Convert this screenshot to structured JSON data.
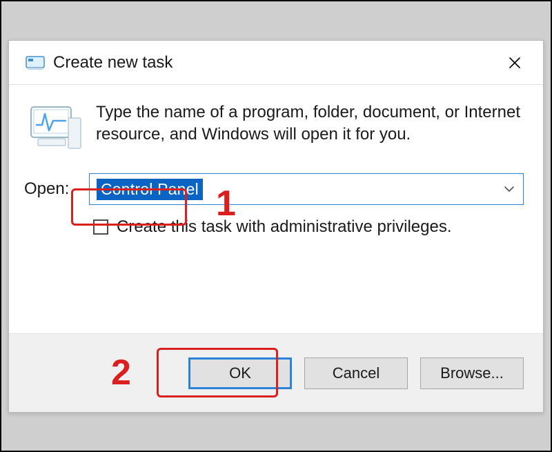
{
  "dialog": {
    "title": "Create new task",
    "prompt": "Type the name of a program, folder, document, or Internet resource, and Windows will open it for you.",
    "open_label": "Open:",
    "open_value": "Control Panel",
    "admin_checkbox_label": "Create this task with administrative privileges.",
    "admin_checked": false,
    "buttons": {
      "ok": "OK",
      "cancel": "Cancel",
      "browse": "Browse..."
    },
    "icons": {
      "app": "run-dialog-icon",
      "machine": "pc-activity-icon",
      "close": "close-icon",
      "dropdown": "chevron-down-icon"
    }
  },
  "annotations": {
    "step1": "1",
    "step2": "2"
  },
  "colors": {
    "annotation_red": "#db1f1f",
    "focus_blue": "#2a83d8",
    "selection_blue": "#0b63c4"
  }
}
